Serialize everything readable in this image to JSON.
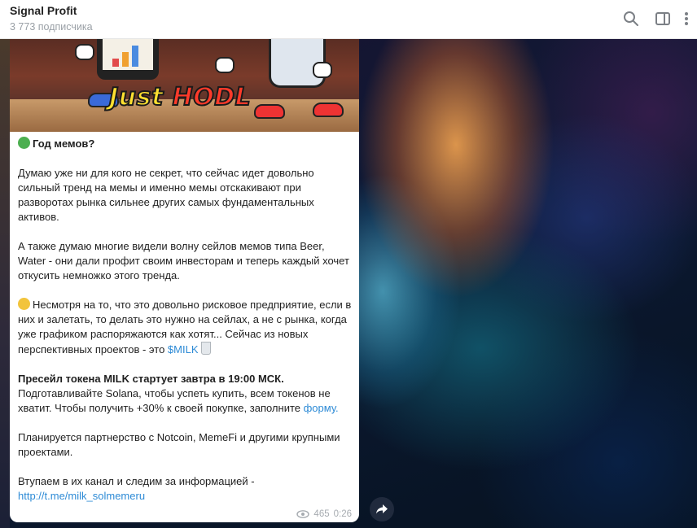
{
  "header": {
    "title": "Signal Profit",
    "subtitle": "3 773 подписчика"
  },
  "icons": {
    "search": "search-icon",
    "sidebar": "sidebar-toggle-icon",
    "menu": "more-vertical-icon",
    "views": "eye-icon",
    "share": "share-arrow-icon"
  },
  "media": {
    "caption_part1": "Just",
    "caption_part2": "HODL"
  },
  "message": {
    "heading": "Год мемов?",
    "p1": "Думаю уже ни для кого не секрет, что сейчас идет довольно сильный тренд на мемы и именно мемы отскакивают при разворотах рынка сильнее других самых фундаментальных активов.",
    "p2": "А также думаю многие видели волну сейлов мемов типа Beer, Water - они дали профит своим инвесторам и теперь каждый хочет откусить немножко этого тренда.",
    "p3_text": "Несмотря на то, что это довольно рисковое предприятие, если в них и залетать, то делать это нужно на сейлах, а не с рынка, когда уже графиком распоряжаются как хотят... Сейчас из новых перспективных проектов - это ",
    "p3_link": "$MILK",
    "p4_bold": "Пресейл токена MILK стартует завтра в 19:00 МСК.",
    "p4_text": "Подготавливайте Solana, чтобы успеть купить, всем токенов не хватит. Чтобы получить +30% к своей покупке, заполните ",
    "p4_link": "форму.",
    "p5": "Планируется партнерство с Notcoin, MemeFi и другими крупными проектами.",
    "p6_text": "Втупаем в их канал и следим за информацией -",
    "p6_link": "http://t.me/milk_solmemeru",
    "views": "465",
    "time": "0:26"
  },
  "colors": {
    "link": "#2e8bd6",
    "meta": "#a6abb0",
    "header_bg": "#ffffff"
  }
}
